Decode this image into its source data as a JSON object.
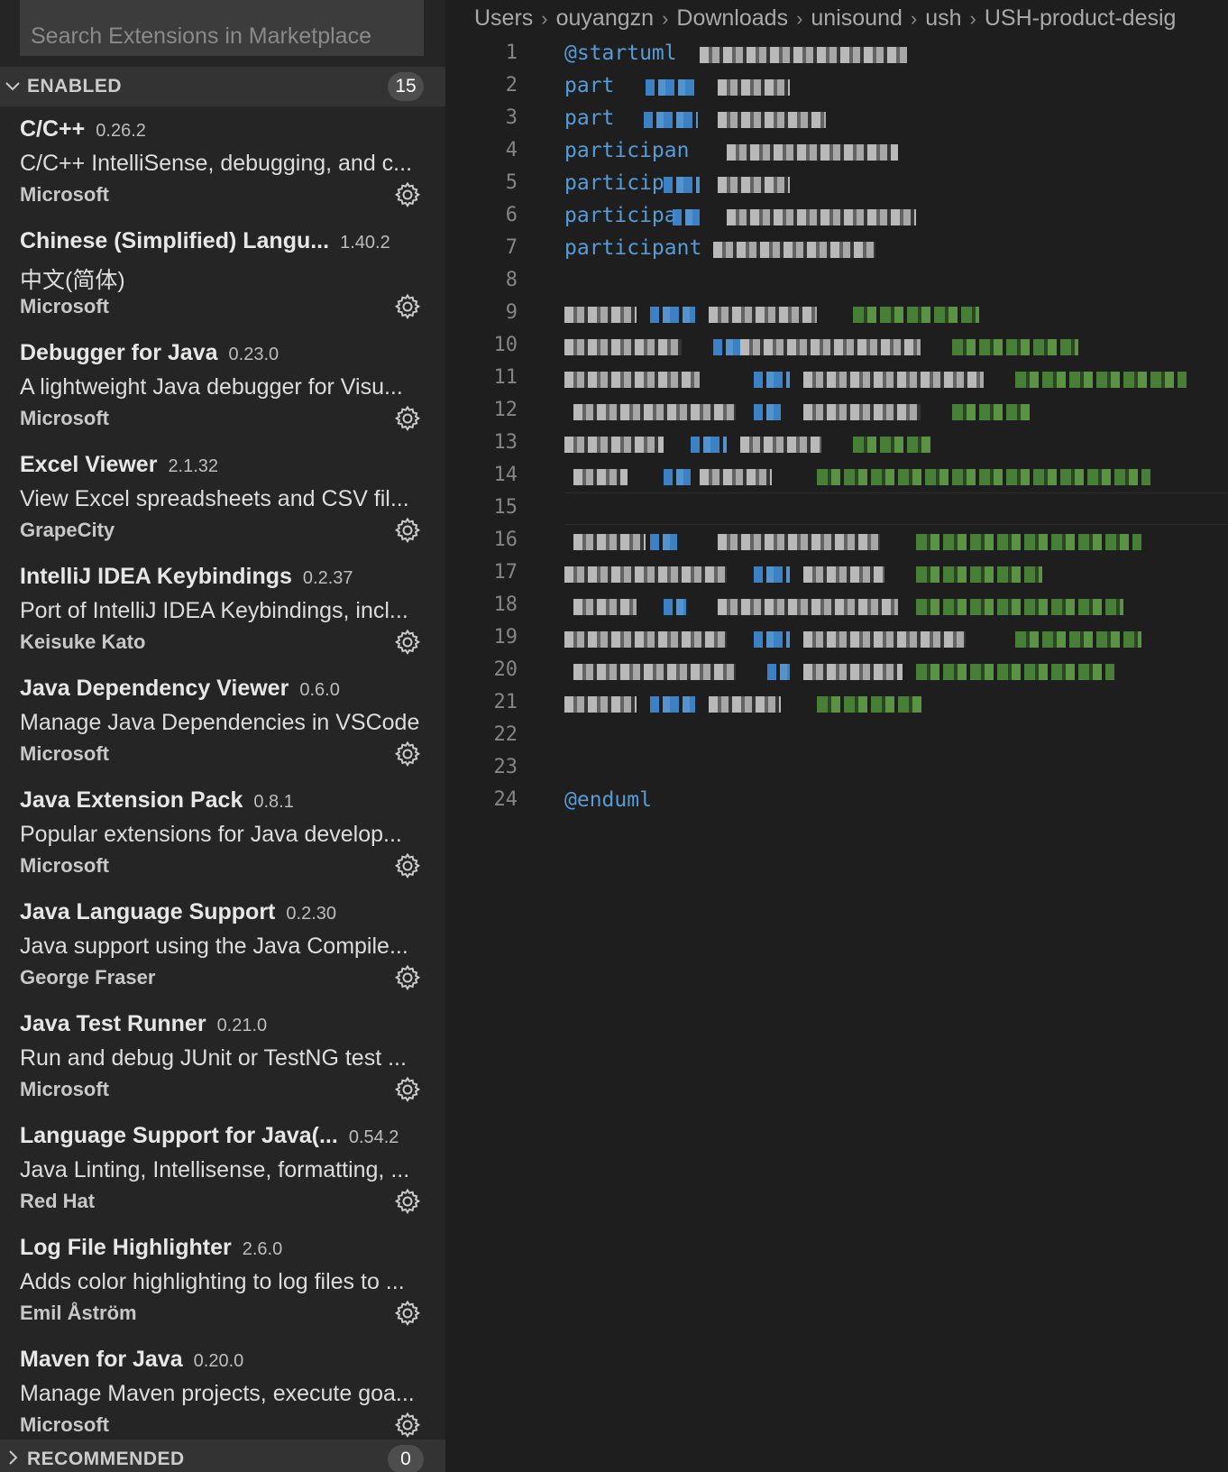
{
  "search": {
    "placeholder": "Search Extensions in Marketplace"
  },
  "enabled": {
    "title": "ENABLED",
    "count": "15"
  },
  "recommended": {
    "title": "RECOMMENDED",
    "count": "0"
  },
  "extensions": [
    {
      "name": "C/C++",
      "version": "0.26.2",
      "desc": "C/C++ IntelliSense, debugging, and c...",
      "publisher": "Microsoft"
    },
    {
      "name": "Chinese (Simplified) Langu...",
      "version": "1.40.2",
      "desc": "中文(简体)",
      "publisher": "Microsoft"
    },
    {
      "name": "Debugger for Java",
      "version": "0.23.0",
      "desc": "A lightweight Java debugger for Visu...",
      "publisher": "Microsoft"
    },
    {
      "name": "Excel Viewer",
      "version": "2.1.32",
      "desc": "View Excel spreadsheets and CSV fil...",
      "publisher": "GrapeCity"
    },
    {
      "name": "IntelliJ IDEA Keybindings",
      "version": "0.2.37",
      "desc": "Port of IntelliJ IDEA Keybindings, incl...",
      "publisher": "Keisuke Kato"
    },
    {
      "name": "Java Dependency Viewer",
      "version": "0.6.0",
      "desc": "Manage Java Dependencies in VSCode",
      "publisher": "Microsoft"
    },
    {
      "name": "Java Extension Pack",
      "version": "0.8.1",
      "desc": "Popular extensions for Java develop...",
      "publisher": "Microsoft"
    },
    {
      "name": "Java Language Support",
      "version": "0.2.30",
      "desc": "Java support using the Java Compile...",
      "publisher": "George Fraser"
    },
    {
      "name": "Java Test Runner",
      "version": "0.21.0",
      "desc": "Run and debug JUnit or TestNG test ...",
      "publisher": "Microsoft"
    },
    {
      "name": "Language Support for Java(...",
      "version": "0.54.2",
      "desc": "Java Linting, Intellisense, formatting, ...",
      "publisher": "Red Hat"
    },
    {
      "name": "Log File Highlighter",
      "version": "2.6.0",
      "desc": "Adds color highlighting to log files to ...",
      "publisher": "Emil Åström"
    },
    {
      "name": "Maven for Java",
      "version": "0.20.0",
      "desc": "Manage Maven projects, execute goa...",
      "publisher": "Microsoft"
    }
  ],
  "icons": {
    "gear": "gear-icon",
    "chevron_down": "chevron-down-icon",
    "chevron_right": "chevron-right-icon"
  },
  "breadcrumb": [
    "Users",
    "ouyangzn",
    "Downloads",
    "unisound",
    "ush",
    "USH-product-desig"
  ],
  "code": {
    "lines": [
      {
        "n": "1",
        "text": "@startuml"
      },
      {
        "n": "2",
        "text": "part"
      },
      {
        "n": "3",
        "text": "part"
      },
      {
        "n": "4",
        "text": "participan"
      },
      {
        "n": "5",
        "text": "particip"
      },
      {
        "n": "6",
        "text": "participa"
      },
      {
        "n": "7",
        "text": "participant"
      },
      {
        "n": "8",
        "text": ""
      },
      {
        "n": "9",
        "text": ""
      },
      {
        "n": "10",
        "text": ""
      },
      {
        "n": "11",
        "text": ""
      },
      {
        "n": "12",
        "text": ""
      },
      {
        "n": "13",
        "text": ""
      },
      {
        "n": "14",
        "text": ""
      },
      {
        "n": "15",
        "text": ""
      },
      {
        "n": "16",
        "text": ""
      },
      {
        "n": "17",
        "text": ""
      },
      {
        "n": "18",
        "text": ""
      },
      {
        "n": "19",
        "text": ""
      },
      {
        "n": "20",
        "text": ""
      },
      {
        "n": "21",
        "text": ""
      },
      {
        "n": "22",
        "text": ""
      },
      {
        "n": "23",
        "text": ""
      },
      {
        "n": "24",
        "text": "@enduml"
      }
    ]
  },
  "colors": {
    "sidebar_bg": "#252526",
    "editor_bg": "#1e1e1e",
    "keyword": "#569cd6",
    "line_number": "#858585",
    "header_bg": "#333334"
  }
}
